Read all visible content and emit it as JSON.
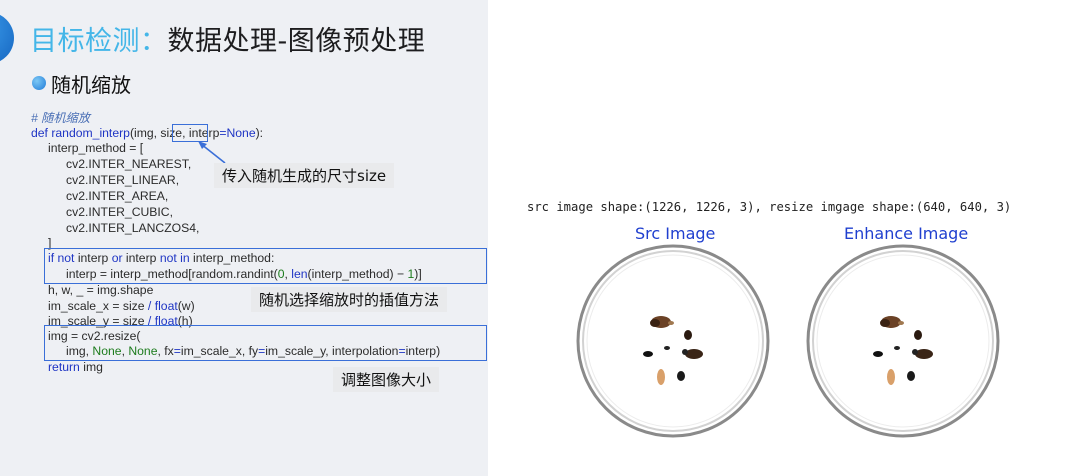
{
  "slide": {
    "title_prefix": "目标检测：",
    "title_rest": "数据处理-图像预处理",
    "bullet": "随机缩放"
  },
  "code": {
    "comment": "# 随机缩放",
    "def": "def",
    "fn_name": "random_interp",
    "sig_open": "(img, ",
    "size": "size,",
    "sig_interp": " interp",
    "eq": "=",
    "none": "None",
    "sig_close": "):",
    "l_interp_method": "interp_method = [",
    "methods": [
      "cv2.INTER_NEAREST,",
      "cv2.INTER_LINEAR,",
      "cv2.INTER_AREA,",
      "cv2.INTER_CUBIC,",
      "cv2.INTER_LANCZOS4,"
    ],
    "close_bracket": "]",
    "if_kw1": "if not",
    "if_mid1": " interp ",
    "if_kw2": "or",
    "if_mid2": " interp ",
    "if_kw3": "not in",
    "if_end": " interp_method:",
    "interp_assign_a": "interp = interp_method[random.randint(",
    "zero": "0",
    "interp_assign_b": ", ",
    "len_kw": "len",
    "interp_assign_c": "(interp_method) − ",
    "one": "1",
    "interp_assign_d": ")]",
    "shape_line": "h, w, _ = img.shape",
    "scale_x_a": "im_scale_x = size ",
    "div": "/",
    "float_kw": "float",
    "scale_x_b": "(w)",
    "scale_y_a": "im_scale_y = size ",
    "scale_y_b": "(h)",
    "resize_line": "img = cv2.resize(",
    "resize_args_a": "img, ",
    "resize_args_b": ", ",
    "resize_args_c": ", fx",
    "resize_args_d": "im_scale_x, fy",
    "resize_args_e": "im_scale_y, interpolation",
    "resize_args_f": "interp)",
    "return_kw": "return",
    "return_rest": " img"
  },
  "annotations": {
    "size_note": "传入随机生成的尺寸size",
    "interp_note": "随机选择缩放时的插值方法",
    "resize_note": "调整图像大小"
  },
  "result": {
    "shape_text": "src image shape:(1226, 1226, 3), resize imgage shape:(640, 640, 3)",
    "src_title": "Src Image",
    "enhance_title": "Enhance Image"
  },
  "colors": {
    "accent_blue": "#3a6fd8",
    "keyword": "#1f35c4",
    "number": "#1d7c1d",
    "title_prefix": "#44b6e8"
  }
}
